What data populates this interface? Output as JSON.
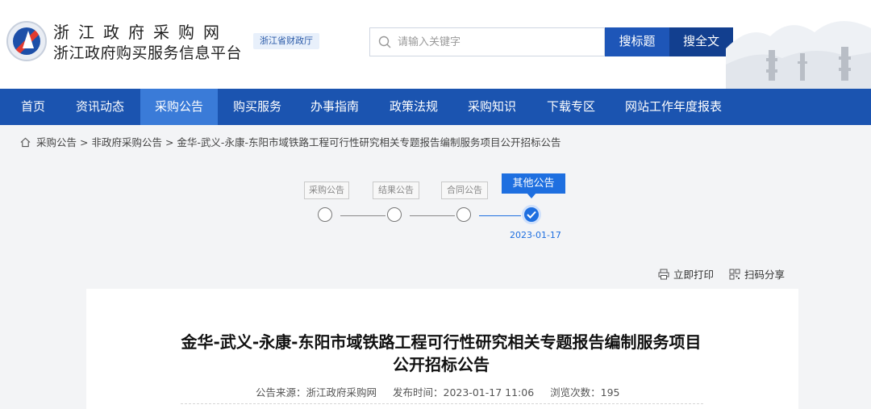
{
  "header": {
    "site_name": "浙江政府采购网",
    "site_subtitle": "浙江政府购买服务信息平台",
    "dept_badge": "浙江省财政厅",
    "search": {
      "placeholder": "请输入关键字"
    },
    "search_title_button": "搜标题",
    "search_full_button": "搜全文"
  },
  "nav": {
    "items": [
      {
        "label": "首页",
        "active": false
      },
      {
        "label": "资讯动态",
        "active": false
      },
      {
        "label": "采购公告",
        "active": true
      },
      {
        "label": "购买服务",
        "active": false
      },
      {
        "label": "办事指南",
        "active": false
      },
      {
        "label": "政策法规",
        "active": false
      },
      {
        "label": "采购知识",
        "active": false
      },
      {
        "label": "下载专区",
        "active": false
      },
      {
        "label": "网站工作年度报表",
        "active": false
      }
    ]
  },
  "breadcrumb": {
    "items": [
      "采购公告",
      "非政府采购公告",
      "金华-武义-永康-东阳市域铁路工程可行性研究相关专题报告编制服务项目公开招标公告"
    ],
    "separator": ">"
  },
  "timeline": {
    "stages": [
      {
        "label": "采购公告",
        "done": false
      },
      {
        "label": "结果公告",
        "done": false
      },
      {
        "label": "合同公告",
        "done": false
      },
      {
        "label": "其他公告",
        "done": true
      }
    ],
    "date": "2023-01-17"
  },
  "tools": {
    "print": "立即打印",
    "share": "扫码分享"
  },
  "article": {
    "title": "金华-武义-永康-东阳市域铁路工程可行性研究相关专题报告编制服务项目公开招标公告",
    "source": "公告来源：浙江政府采购网",
    "publish_time": "发布时间：2023-01-17 11:06",
    "views": "浏览次数：195"
  },
  "colors": {
    "primary": "#1b54b0",
    "nav_active": "#3a7bd8",
    "accent": "#1e6fe0"
  }
}
